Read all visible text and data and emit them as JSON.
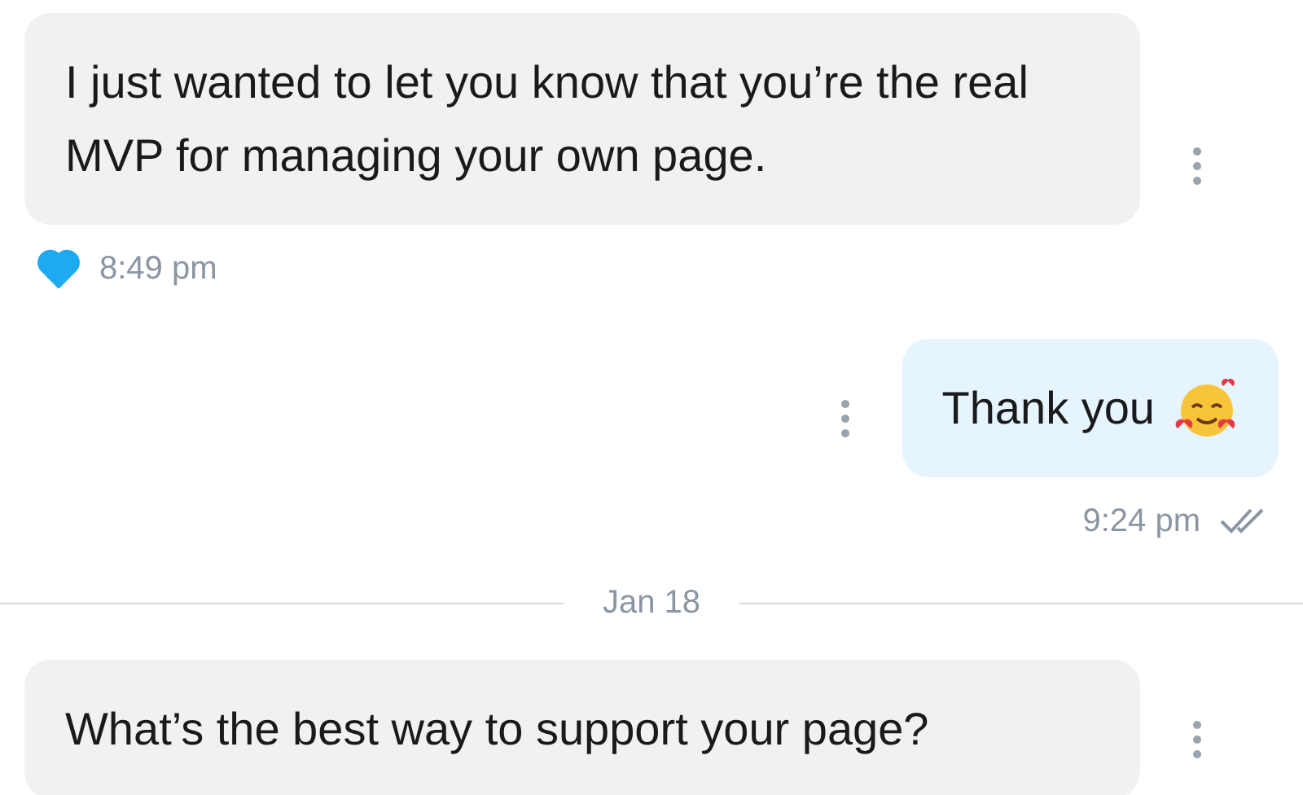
{
  "messages": [
    {
      "kind": "message",
      "outgoing": false,
      "text": "I just wanted to let you know that you’re the real MVP for managing your own page.",
      "time": "8:49 pm",
      "liked": true
    },
    {
      "kind": "message",
      "outgoing": true,
      "text": "Thank you",
      "emoji": true,
      "time": "9:24 pm",
      "read": true
    },
    {
      "kind": "date",
      "text": "Jan 18"
    },
    {
      "kind": "message",
      "outgoing": false,
      "text": "What’s the best way to support your page?"
    }
  ]
}
